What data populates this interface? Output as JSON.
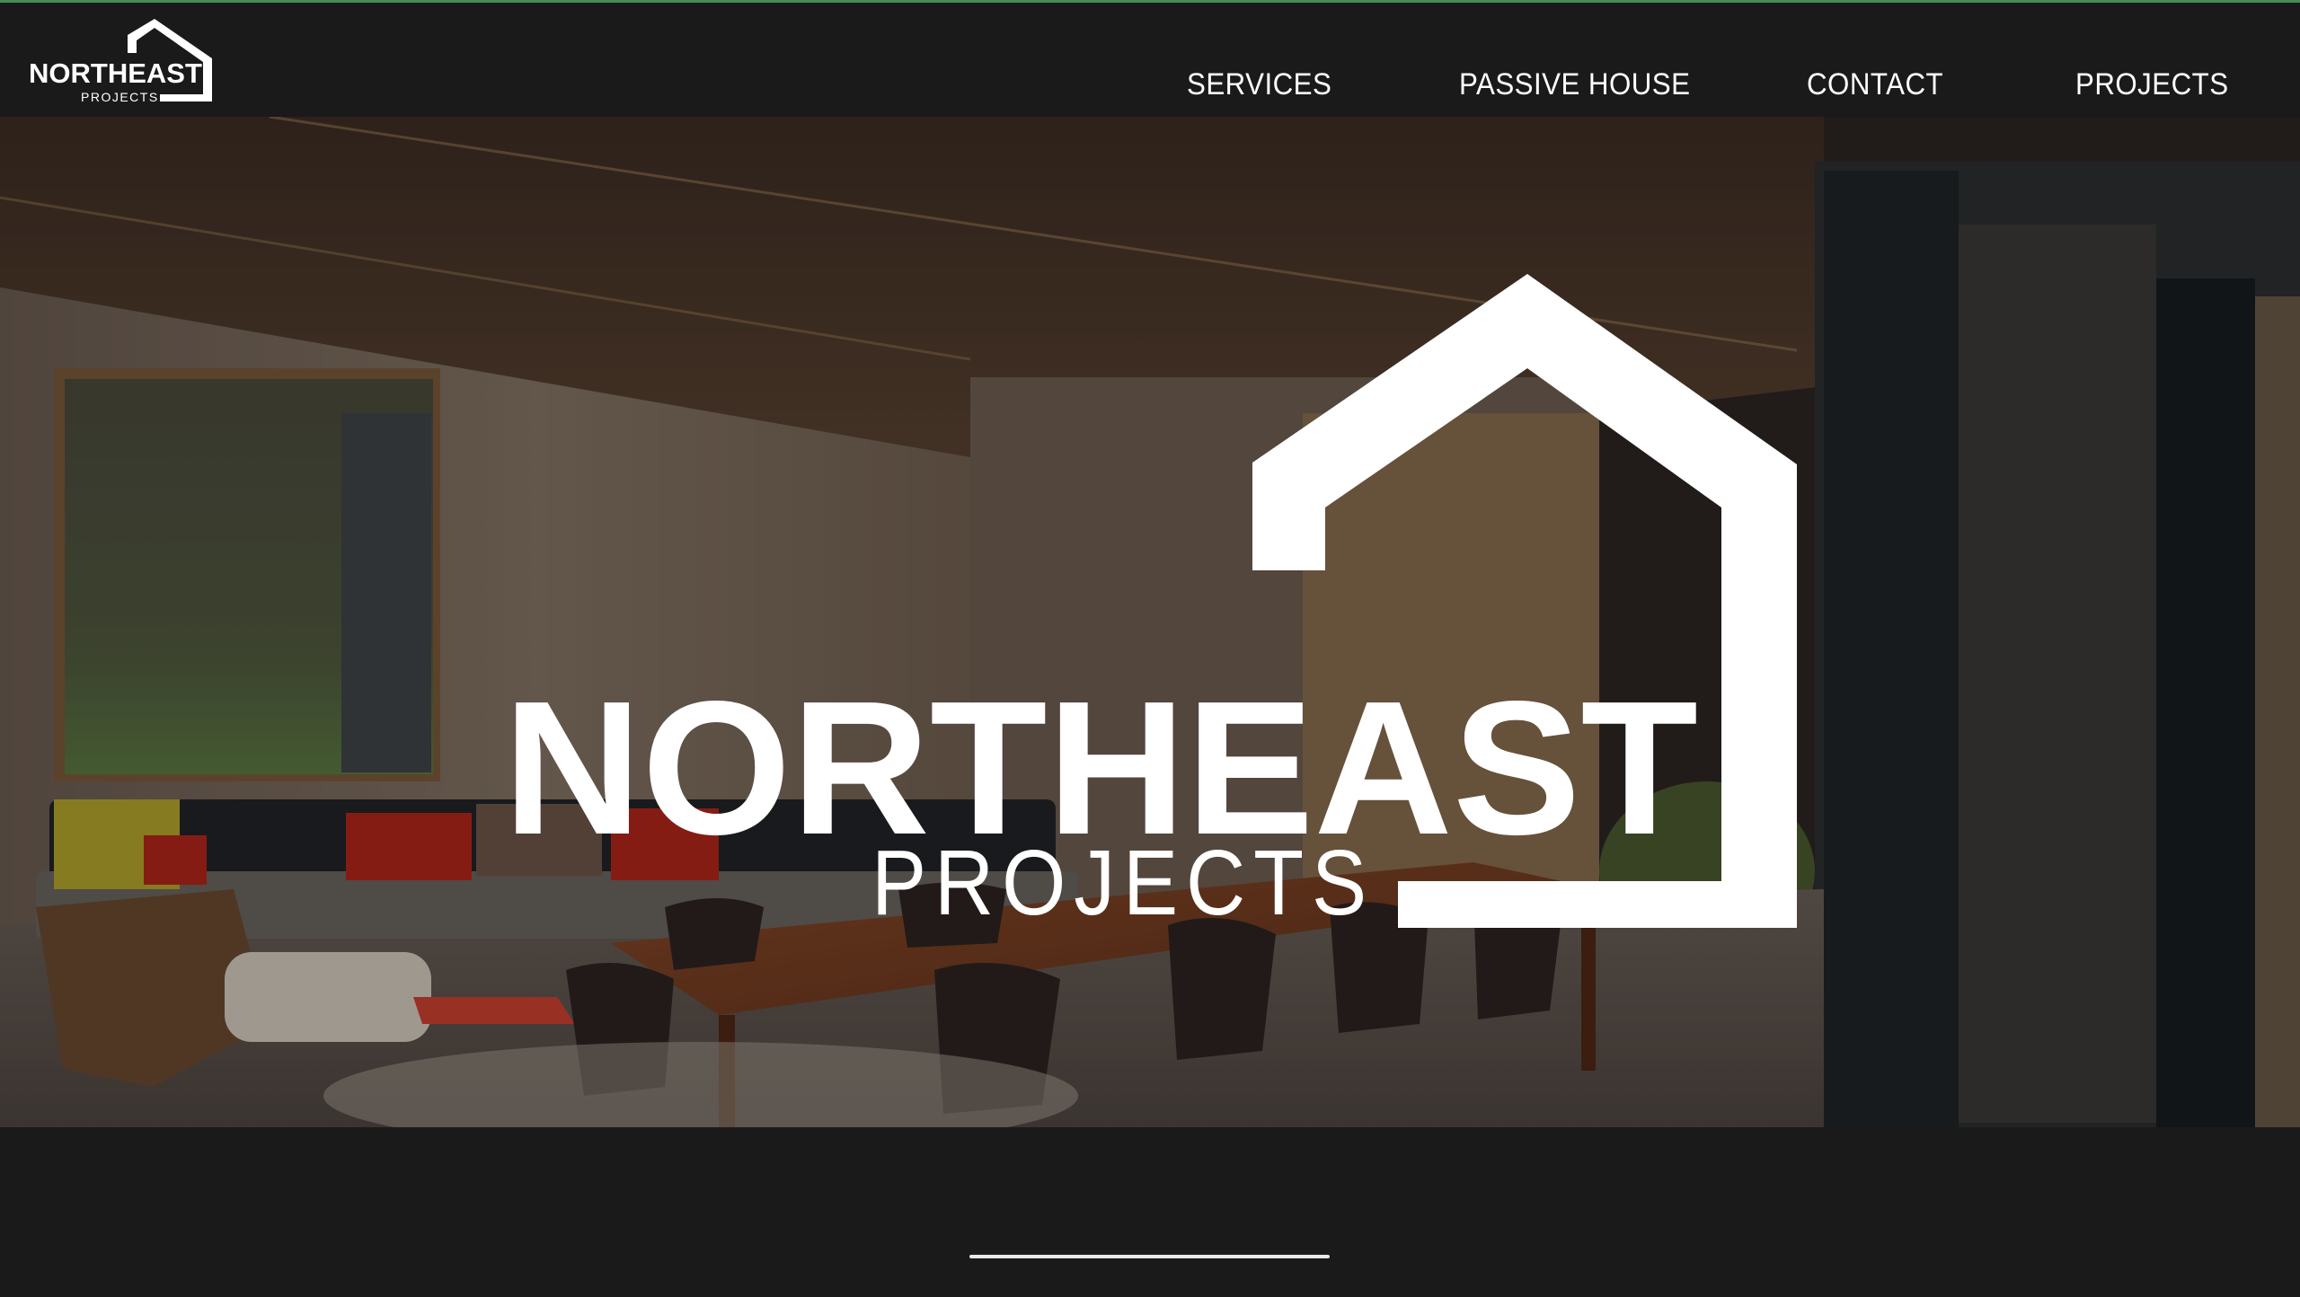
{
  "brand": {
    "name": "NORTHEAST",
    "subtitle": "PROJECTS",
    "logo_icon": "house-outline-icon"
  },
  "nav": {
    "items": [
      {
        "label": "SERVICES"
      },
      {
        "label": "PASSIVE HOUSE"
      },
      {
        "label": "CONTACT"
      },
      {
        "label": "PROJECTS"
      }
    ]
  },
  "hero": {
    "title": "NORTHEAST",
    "subtitle": "PROJECTS",
    "icon": "house-outline-icon"
  },
  "colors": {
    "background": "#1a1a1b",
    "accent_line": "#4a8a5a",
    "text": "#ffffff"
  }
}
